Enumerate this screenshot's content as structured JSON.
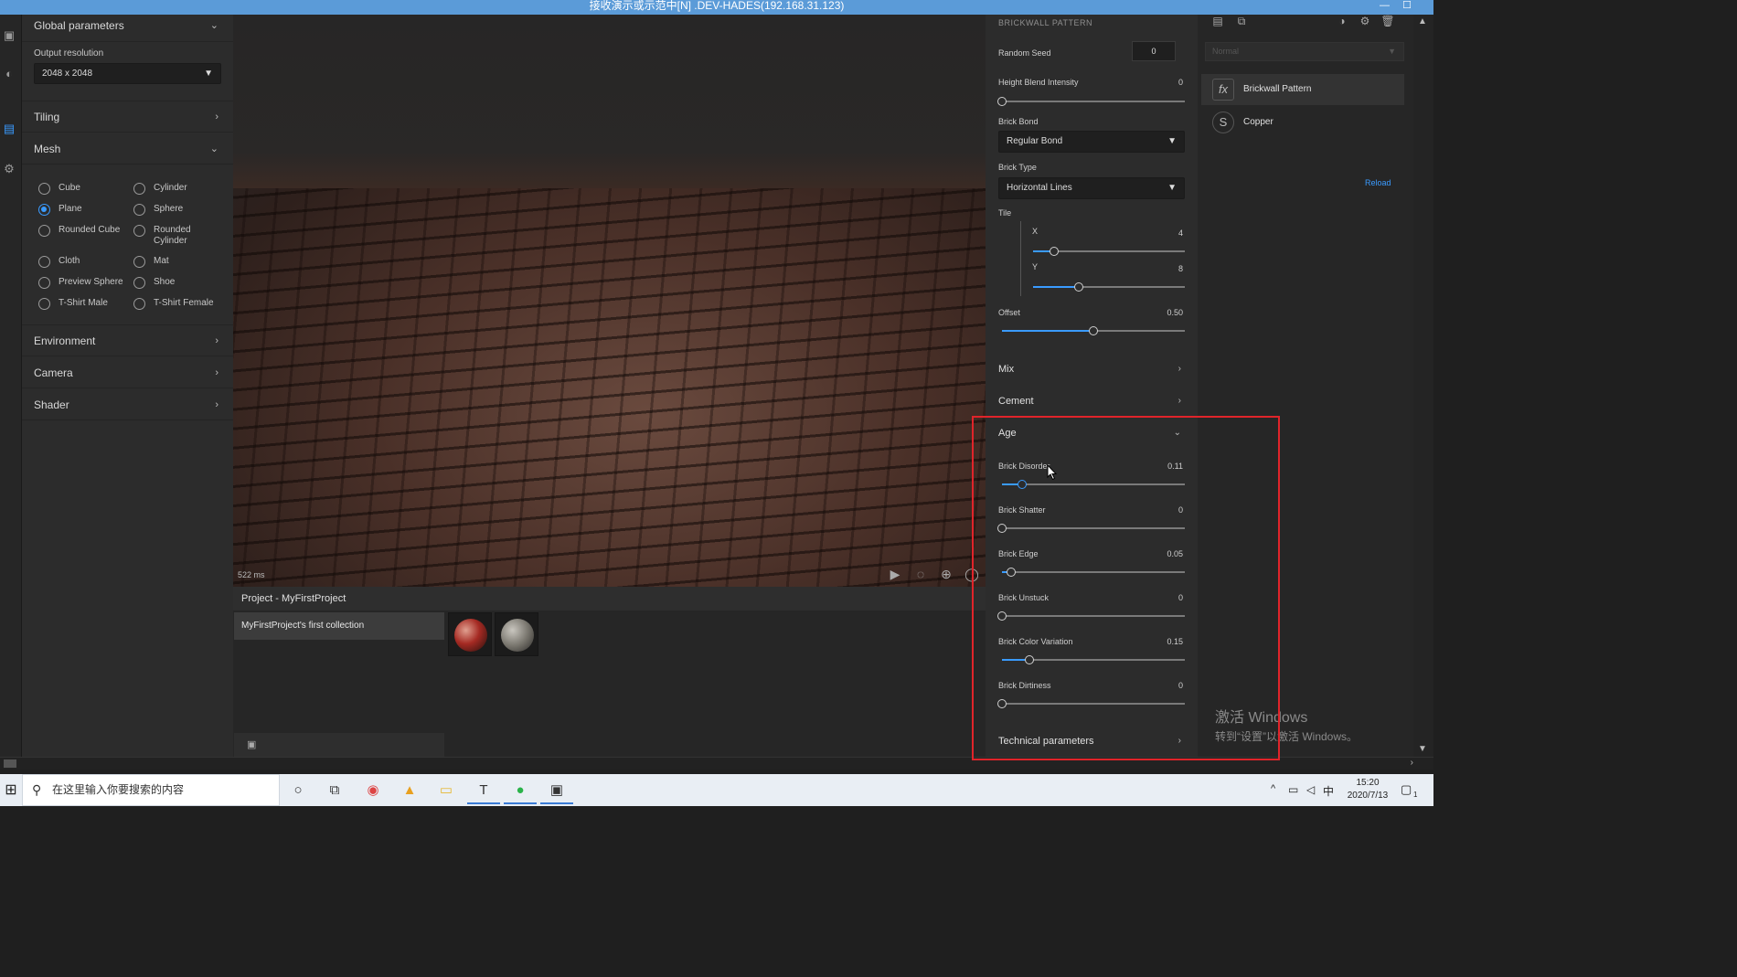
{
  "window": {
    "title": "接收演示或示范中[N] .DEV-HADES(192.168.31.123)",
    "controls": [
      "—",
      "☐"
    ]
  },
  "left_panel": {
    "global": {
      "label": "Global parameters",
      "output_label": "Output resolution",
      "output_value": "2048 x 2048"
    },
    "tiling": "Tiling",
    "mesh": {
      "label": "Mesh",
      "options": [
        {
          "label": "Cube",
          "checked": false
        },
        {
          "label": "Cylinder",
          "checked": false
        },
        {
          "label": "Plane",
          "checked": true
        },
        {
          "label": "Sphere",
          "checked": false
        },
        {
          "label": "Rounded Cube",
          "checked": false
        },
        {
          "label": "Rounded Cylinder",
          "checked": false
        },
        {
          "label": "Cloth",
          "checked": false
        },
        {
          "label": "Mat",
          "checked": false
        },
        {
          "label": "Preview Sphere",
          "checked": false
        },
        {
          "label": "Shoe",
          "checked": false
        },
        {
          "label": "T-Shirt Male",
          "checked": false
        },
        {
          "label": "T-Shirt Female",
          "checked": false
        }
      ]
    },
    "environment": "Environment",
    "camera": "Camera",
    "shader": "Shader"
  },
  "viewport": {
    "render_time": "522 ms"
  },
  "project": {
    "title": "Project - MyFirstProject",
    "collection": "MyFirstProject's first collection"
  },
  "properties": {
    "title": "BRICKWALL PATTERN",
    "random_seed": {
      "label": "Random Seed",
      "value": "0"
    },
    "height_blend": {
      "label": "Height Blend Intensity",
      "value": "0",
      "fraction": 0
    },
    "brick_bond": {
      "label": "Brick Bond",
      "value": "Regular Bond"
    },
    "brick_type": {
      "label": "Brick Type",
      "value": "Horizontal Lines"
    },
    "tile": {
      "label": "Tile",
      "x": {
        "label": "X",
        "value": "4",
        "fraction": 0.14
      },
      "y": {
        "label": "Y",
        "value": "8",
        "fraction": 0.3
      }
    },
    "offset": {
      "label": "Offset",
      "value": "0.50",
      "fraction": 0.5
    },
    "mix": "Mix",
    "cement": "Cement",
    "age": {
      "label": "Age",
      "sliders": [
        {
          "label": "Brick Disorder",
          "value": "0.11",
          "fraction": 0.11
        },
        {
          "label": "Brick Shatter",
          "value": "0",
          "fraction": 0
        },
        {
          "label": "Brick Edge",
          "value": "0.05",
          "fraction": 0.05
        },
        {
          "label": "Brick Unstuck",
          "value": "0",
          "fraction": 0
        },
        {
          "label": "Brick Color Variation",
          "value": "0.15",
          "fraction": 0.15
        },
        {
          "label": "Brick Dirtiness",
          "value": "0",
          "fraction": 0
        }
      ]
    },
    "technical": "Technical parameters"
  },
  "layers": {
    "blend_mode": "Normal",
    "items": [
      {
        "label": "Brickwall Pattern",
        "icon": "fx-icon",
        "selected": true
      },
      {
        "label": "Copper",
        "icon": "substance-icon",
        "selected": false
      }
    ],
    "reload": "Reload"
  },
  "watermark": {
    "line1": "激活 Windows",
    "line2": "转到“设置”以激活 Windows。"
  },
  "taskbar": {
    "search_placeholder": "在这里输入你要搜索的内容",
    "time": "15:20",
    "date": "2020/7/13",
    "ime": "中",
    "notification_count": "1"
  },
  "colors": {
    "accent": "#3a9bff",
    "highlight": "#e0242a",
    "titlebar": "#5b9bd8"
  }
}
